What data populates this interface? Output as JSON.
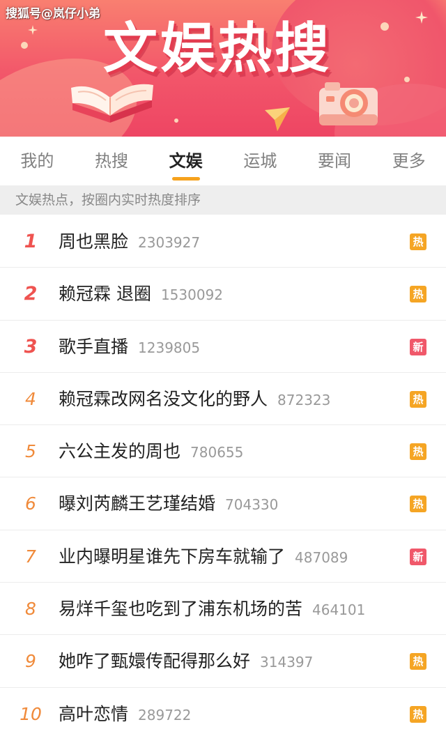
{
  "header": {
    "watermark": "搜狐号@岚仔小弟",
    "title": "文娱热搜"
  },
  "tabs": [
    {
      "label": "我的",
      "active": false
    },
    {
      "label": "热搜",
      "active": false
    },
    {
      "label": "文娱",
      "active": true
    },
    {
      "label": "运城",
      "active": false
    },
    {
      "label": "要闻",
      "active": false
    },
    {
      "label": "更多",
      "active": false
    }
  ],
  "subtitle": "文娱热点，按圈内实时热度排序",
  "colors": {
    "accent_underline": "#f6a21d",
    "rank_top": "#ef5350",
    "rank_other": "#f08a3a",
    "badge_hot": "#f5a524",
    "badge_new": "#f0586a"
  },
  "list": [
    {
      "rank": "1",
      "title": "周也黑脸",
      "heat": "2303927",
      "badge": "热",
      "badge_type": "hot"
    },
    {
      "rank": "2",
      "title": "赖冠霖 退圈",
      "heat": "1530092",
      "badge": "热",
      "badge_type": "hot"
    },
    {
      "rank": "3",
      "title": "歌手直播",
      "heat": "1239805",
      "badge": "新",
      "badge_type": "new"
    },
    {
      "rank": "4",
      "title": "赖冠霖改网名没文化的野人",
      "heat": "872323",
      "badge": "热",
      "badge_type": "hot"
    },
    {
      "rank": "5",
      "title": "六公主发的周也",
      "heat": "780655",
      "badge": "热",
      "badge_type": "hot"
    },
    {
      "rank": "6",
      "title": "曝刘芮麟王艺瑾结婚",
      "heat": "704330",
      "badge": "热",
      "badge_type": "hot"
    },
    {
      "rank": "7",
      "title": "业内曝明星谁先下房车就输了",
      "heat": "487089",
      "badge": "新",
      "badge_type": "new"
    },
    {
      "rank": "8",
      "title": "易烊千玺也吃到了浦东机场的苦",
      "heat": "464101",
      "badge": "",
      "badge_type": "none"
    },
    {
      "rank": "9",
      "title": "她咋了甄嬛传配得那么好",
      "heat": "314397",
      "badge": "热",
      "badge_type": "hot"
    },
    {
      "rank": "10",
      "title": "高叶恋情",
      "heat": "289722",
      "badge": "热",
      "badge_type": "hot"
    }
  ]
}
